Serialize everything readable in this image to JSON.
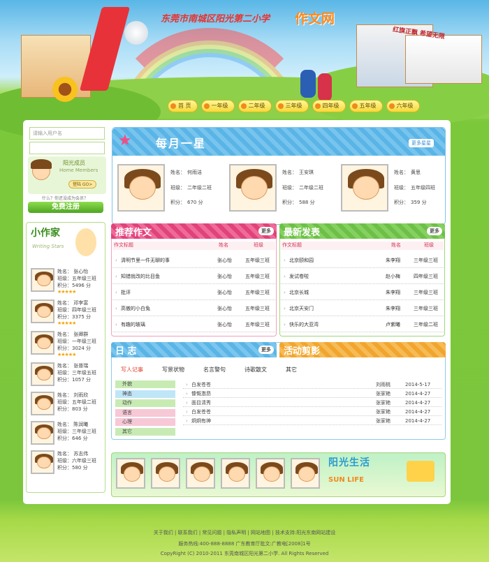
{
  "site": {
    "school": "东莞市南城区阳光第二小学",
    "title": "作文网",
    "banner_tag": "红旗正飘 希望无限"
  },
  "nav": [
    "首 页",
    "一年级",
    "二年级",
    "三年级",
    "四年级",
    "五年级",
    "六年级"
  ],
  "login": {
    "user_placeholder": "请输入用户名",
    "pass_placeholder": "",
    "member_title": "阳光成员",
    "member_sub": "Home Members",
    "login_btn": "登陆 GO>",
    "hint": "什么？你还没成为会员？",
    "register": "免费注册"
  },
  "star": {
    "title": "每月一星",
    "more": "更多星星",
    "members": [
      {
        "name_label": "姓名：",
        "name": "何雨洁",
        "class_label": "班级：",
        "class": "二年级二班",
        "score_label": "积分：",
        "score": "670 分"
      },
      {
        "name_label": "姓名：",
        "name": "王安琪",
        "class_label": "班级：",
        "class": "二年级二班",
        "score_label": "积分：",
        "score": "588 分"
      },
      {
        "name_label": "姓名：",
        "name": "黄思",
        "class_label": "班级：",
        "class": "五年级四班",
        "score_label": "积分：",
        "score": "359 分"
      }
    ]
  },
  "writers": {
    "title": "小作家",
    "subtitle": "Writing Stars",
    "list": [
      {
        "name": "姓名： 张心怡",
        "class": "班级：五年级三班",
        "score": "积分：5496 分",
        "stars": "★★★★★"
      },
      {
        "name": "姓名： 邓李富",
        "class": "班级：四年级三班",
        "score": "积分：3375 分",
        "stars": "★★★★★"
      },
      {
        "name": "姓名： 张卿群",
        "class": "班级：一年级三班",
        "score": "积分：3024 分",
        "stars": "★★★★★"
      },
      {
        "name": "姓名： 张普瑞",
        "class": "班级：三年级五班",
        "score": "积分：1057 分",
        "stars": ""
      },
      {
        "name": "姓名： 刘雨欣",
        "class": "班级：五年级二班",
        "score": "积分：803 分",
        "stars": ""
      },
      {
        "name": "姓名： 陈润曦",
        "class": "班级：三年级三班",
        "score": "积分：646 分",
        "stars": ""
      },
      {
        "name": "姓名： 苏志伟",
        "class": "班级：六年级三班",
        "score": "积分：580 分",
        "stars": ""
      }
    ]
  },
  "recommend": {
    "title": "推荐作文",
    "more": "更多",
    "cols": [
      "作文标题",
      "姓名",
      "班级"
    ],
    "rows": [
      [
        "清明节里一件无聊的事",
        "张心怡",
        "五年级三班"
      ],
      [
        "知错就改的比目鱼",
        "张心怡",
        "五年级三班"
      ],
      [
        "批评",
        "张心怡",
        "五年级三班"
      ],
      [
        "高傲的小白兔",
        "张心怡",
        "五年级三班"
      ],
      [
        "有趣的玻璃",
        "张心怡",
        "五年级三班"
      ]
    ]
  },
  "latest": {
    "title": "最新发表",
    "more": "更多",
    "cols": [
      "作文标题",
      "姓名",
      "班级"
    ],
    "rows": [
      [
        "北京颐和园",
        "朱李翔",
        "三年级三班"
      ],
      [
        "发试卷啦",
        "赵小梅",
        "四年级三班"
      ],
      [
        "北京长城",
        "朱李翔",
        "三年级三班"
      ],
      [
        "北京天安门",
        "朱李翔",
        "三年级三班"
      ],
      [
        "快乐的大亚湾",
        "卢紫曦",
        "三年级二班"
      ]
    ]
  },
  "diary": {
    "title": "日 志",
    "more": "更多",
    "tabs": [
      "写人记事",
      "写景状物",
      "名言警句",
      "诗歌散文",
      "其它"
    ],
    "cats": [
      "外貌",
      "神态",
      "动作",
      "语言",
      "心理",
      "其它"
    ],
    "rows": [
      [
        "白发苍苍",
        "刘雨桃",
        "2014-5-17"
      ],
      [
        "慷慨激昂",
        "张家艳",
        "2014-4-27"
      ],
      [
        "面目清秀",
        "张家艳",
        "2014-4-27"
      ],
      [
        "白发苍苍",
        "张家艳",
        "2014-4-27"
      ],
      [
        "炯炯有神",
        "张家艳",
        "2014-4-27"
      ]
    ]
  },
  "activity": {
    "title": "活动剪影"
  },
  "sunlife": {
    "title": "阳光生活",
    "sub": "SUN LIFE"
  },
  "footer": {
    "links": "关于我们 | 联系我们 | 常见问题 | 隐私声明 | 网站地图 | 技术支持:阳光东南网站建设",
    "line2": "服务热线:400-888-8888 广东教育厅批文:广教电[2008]1号",
    "line3": "CopyRight (C) 2010-2011 东莞南城区阳光第二小学. All Rights Reserved"
  },
  "colors": {
    "blue": "#5ab4e6",
    "pink": "#e0427a",
    "green": "#6cc046",
    "orange": "#f2a52e",
    "gold": "#f4e24b"
  }
}
